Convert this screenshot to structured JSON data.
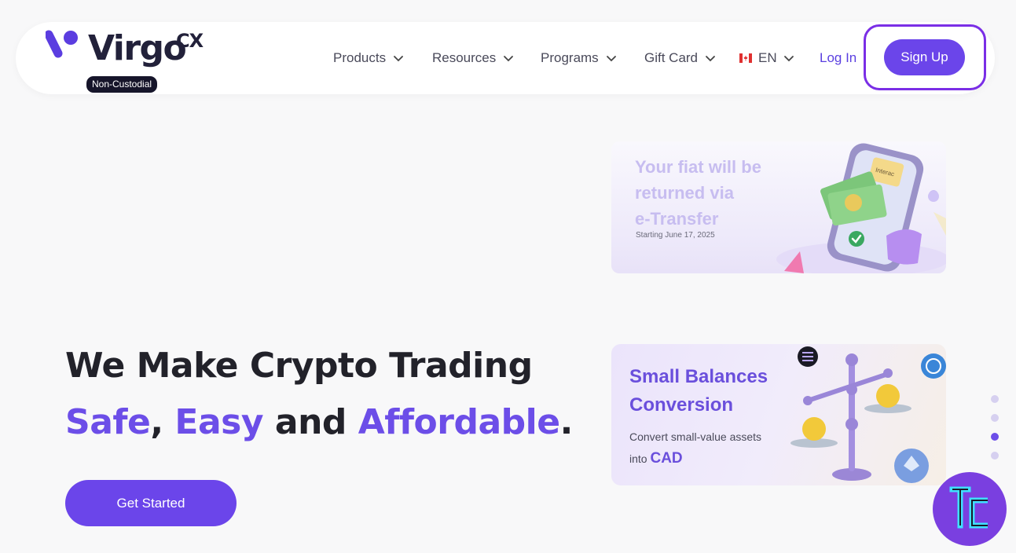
{
  "navbar": {
    "logo_text": "Virgo",
    "logo_suffix": "CX",
    "badge": "Non-Custodial",
    "items": [
      {
        "label": "Products"
      },
      {
        "label": "Resources"
      },
      {
        "label": "Programs"
      },
      {
        "label": "Gift Card"
      }
    ],
    "language": "EN",
    "login_label": "Log In",
    "signup_label": "Sign Up"
  },
  "hero": {
    "line1": "We Make Crypto Trading",
    "w_safe": "Safe",
    "comma": ",",
    "w_easy": "Easy",
    "w_and": "and",
    "w_affordable": "Affordable",
    "period": ".",
    "cta_label": "Get Started"
  },
  "cards": {
    "card1": {
      "title_line1": "Your fiat will be",
      "title_line2": "returned via",
      "title_line3": "e-Transfer",
      "date": "Starting June 17, 2025",
      "phone_label": "Interac"
    },
    "card2": {
      "title_line1": "Small Balances",
      "title_line2": "Conversion",
      "desc_line1": "Convert small-value assets",
      "desc_into": "into",
      "desc_cad": "CAD"
    }
  },
  "carousel": {
    "count": 4,
    "active_index": 2
  },
  "colors": {
    "accent": "#6c4ee8",
    "button": "#6b45ea",
    "ring": "#7a2ee6"
  }
}
